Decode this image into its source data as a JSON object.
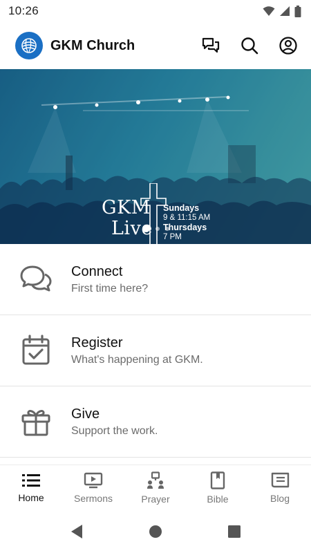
{
  "status_bar": {
    "time": "10:26"
  },
  "header": {
    "title": "GKM Church"
  },
  "hero": {
    "word1": "GKM",
    "word2": "Live",
    "schedule": [
      {
        "day": "Sundays",
        "time": "9 & 11:15 AM"
      },
      {
        "day": "Thursdays",
        "time": "7 PM"
      }
    ],
    "slide_count": 3,
    "active_slide": 1
  },
  "menu": [
    {
      "title": "Connect",
      "subtitle": "First time here?"
    },
    {
      "title": "Register",
      "subtitle": "What's happening at GKM."
    },
    {
      "title": "Give",
      "subtitle": "Support the work."
    }
  ],
  "bottom_nav": [
    {
      "label": "Home",
      "icon": "list-icon",
      "active": true
    },
    {
      "label": "Sermons",
      "icon": "tv-play-icon",
      "active": false
    },
    {
      "label": "Prayer",
      "icon": "prayer-icon",
      "active": false
    },
    {
      "label": "Bible",
      "icon": "book-icon",
      "active": false
    },
    {
      "label": "Blog",
      "icon": "blog-icon",
      "active": false
    }
  ],
  "colors": {
    "brand_blue": "#1a6fc4",
    "hero_teal": "#2a8ea8",
    "icon_gray": "#666666",
    "text_secondary": "#6b6b6b"
  }
}
